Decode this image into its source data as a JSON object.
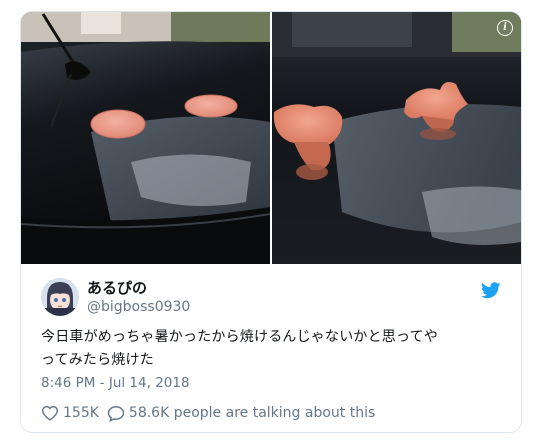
{
  "tweet": {
    "display_name": "あるぴの",
    "handle": "@bigboss0930",
    "text_line1": "今日車がめっちゃ暑かったから焼けるんじゃないかと思ってや",
    "text_line2": "ってみたら焼けた",
    "timestamp": "8:46 PM - Jul 14, 2018",
    "likes": "155K",
    "replies_text": "58.6K people are talking about this"
  },
  "icons": {
    "info": "info-icon",
    "brand": "twitter-bird-icon",
    "like": "heart-icon",
    "reply": "speech-bubble-icon"
  },
  "colors": {
    "brand_blue": "#1da1f2",
    "secondary_text": "#657786",
    "primary_text": "#14171a",
    "border": "#e1e8ed"
  }
}
